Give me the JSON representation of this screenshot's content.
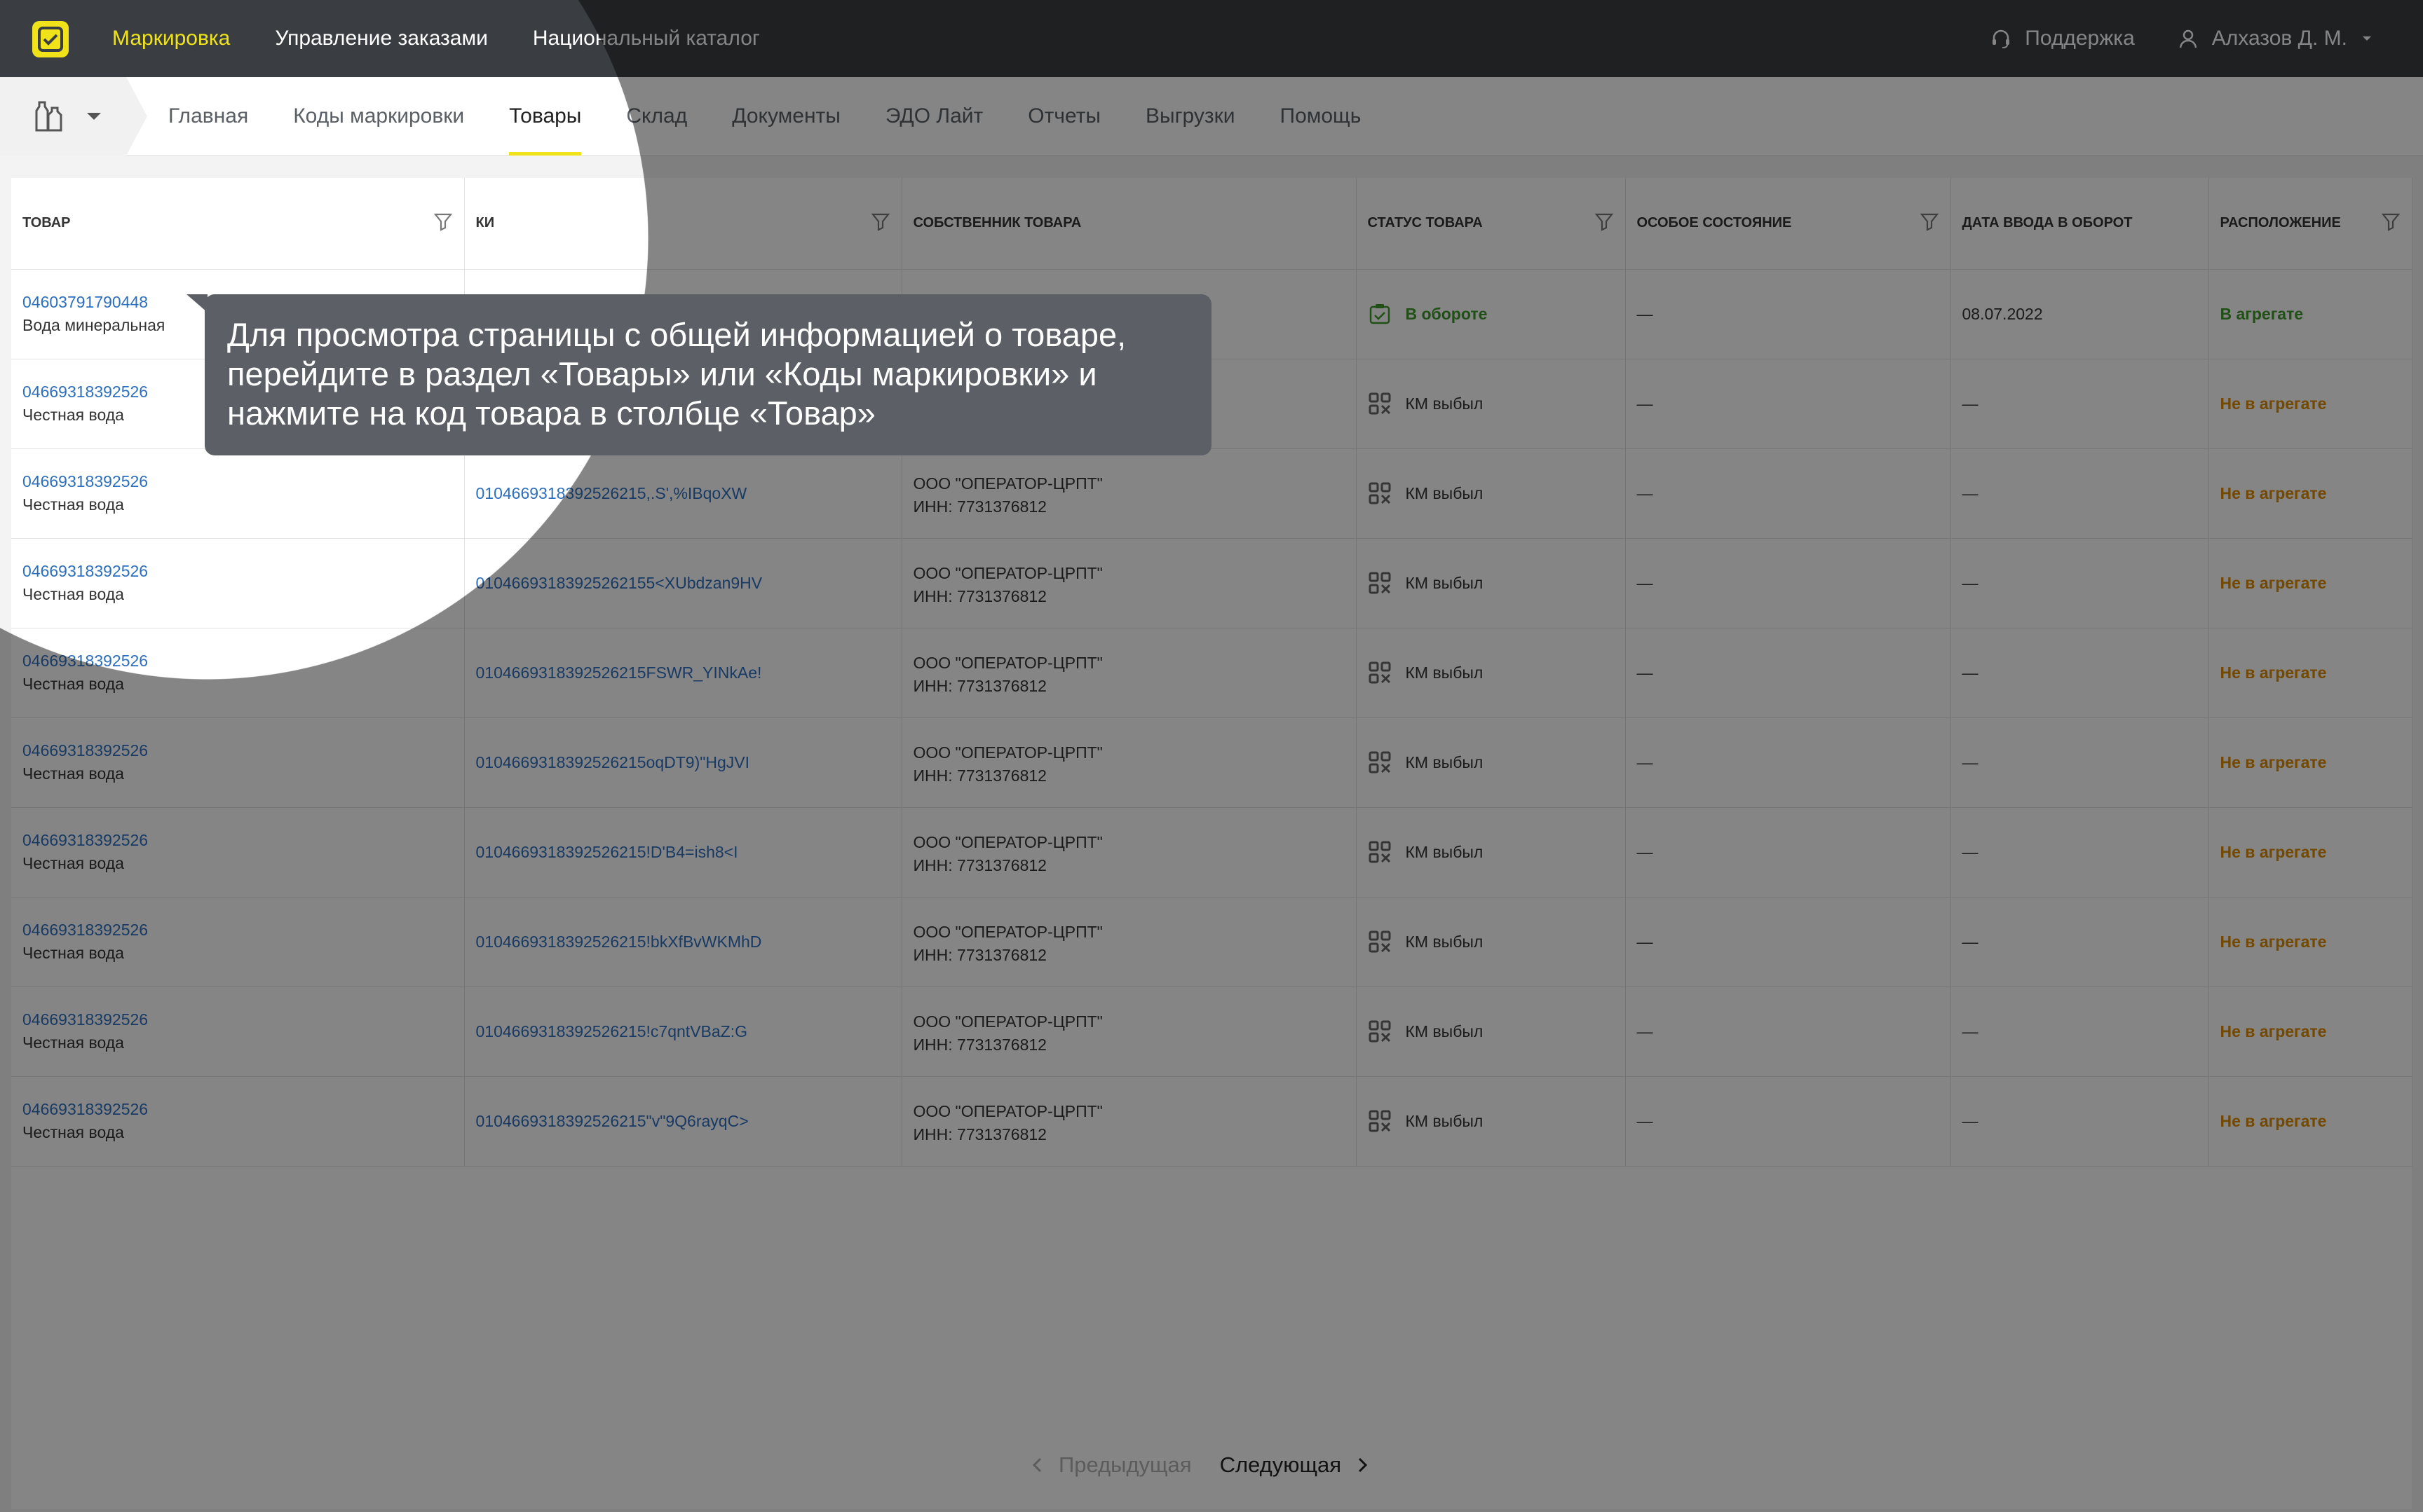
{
  "header": {
    "nav": [
      "Маркировка",
      "Управление заказами",
      "Национальный каталог"
    ],
    "active_index": 0,
    "support_label": "Поддержка",
    "user_name": "Алхазов Д. М."
  },
  "subnav": {
    "tabs": [
      "Главная",
      "Коды маркировки",
      "Товары",
      "Склад",
      "Документы",
      "ЭДО Лайт",
      "Отчеты",
      "Выгрузки",
      "Помощь"
    ],
    "active_index": 2
  },
  "table": {
    "columns": [
      "Товар",
      "КИ",
      "Собственник товара",
      "Статус товара",
      "Особое состояние",
      "Дата ввода в оборот",
      "Расположение"
    ],
    "rows": [
      {
        "gtin": "04603791790448",
        "name": "Вода минеральная",
        "ki": "",
        "owner": "",
        "inn": "",
        "status": "В обороте",
        "special": "—",
        "date": "08.07.2022",
        "location": "В агрегате"
      },
      {
        "gtin": "04669318392526",
        "name": "Честная вода",
        "ki": "",
        "owner": "",
        "inn": "",
        "status": "КМ выбыл",
        "special": "—",
        "date": "—",
        "location": "Не в агрегате"
      },
      {
        "gtin": "04669318392526",
        "name": "Честная вода",
        "ki": "0104669318392526215,.S',%IBqoXW",
        "owner": "ООО \"ОПЕРАТОР-ЦРПТ\"",
        "inn": "ИНН: 7731376812",
        "status": "КМ выбыл",
        "special": "—",
        "date": "—",
        "location": "Не в агрегате"
      },
      {
        "gtin": "04669318392526",
        "name": "Честная вода",
        "ki": "01046693183925262155<XUbdzan9HV",
        "owner": "ООО \"ОПЕРАТОР-ЦРПТ\"",
        "inn": "ИНН: 7731376812",
        "status": "КМ выбыл",
        "special": "—",
        "date": "—",
        "location": "Не в агрегате"
      },
      {
        "gtin": "04669318392526",
        "name": "Честная вода",
        "ki": "0104669318392526215FSWR_YINkAe!",
        "owner": "ООО \"ОПЕРАТОР-ЦРПТ\"",
        "inn": "ИНН: 7731376812",
        "status": "КМ выбыл",
        "special": "—",
        "date": "—",
        "location": "Не в агрегате"
      },
      {
        "gtin": "04669318392526",
        "name": "Честная вода",
        "ki": "0104669318392526215oqDT9)\"HgJVI",
        "owner": "ООО \"ОПЕРАТОР-ЦРПТ\"",
        "inn": "ИНН: 7731376812",
        "status": "КМ выбыл",
        "special": "—",
        "date": "—",
        "location": "Не в агрегате"
      },
      {
        "gtin": "04669318392526",
        "name": "Честная вода",
        "ki": "0104669318392526215!D'B4=ish8<I",
        "owner": "ООО \"ОПЕРАТОР-ЦРПТ\"",
        "inn": "ИНН: 7731376812",
        "status": "КМ выбыл",
        "special": "—",
        "date": "—",
        "location": "Не в агрегате"
      },
      {
        "gtin": "04669318392526",
        "name": "Честная вода",
        "ki": "0104669318392526215!bkXfBvWKMhD",
        "owner": "ООО \"ОПЕРАТОР-ЦРПТ\"",
        "inn": "ИНН: 7731376812",
        "status": "КМ выбыл",
        "special": "—",
        "date": "—",
        "location": "Не в агрегате"
      },
      {
        "gtin": "04669318392526",
        "name": "Честная вода",
        "ki": "0104669318392526215!c7qntVBaZ:G",
        "owner": "ООО \"ОПЕРАТОР-ЦРПТ\"",
        "inn": "ИНН: 7731376812",
        "status": "КМ выбыл",
        "special": "—",
        "date": "—",
        "location": "Не в агрегате"
      },
      {
        "gtin": "04669318392526",
        "name": "Честная вода",
        "ki": "0104669318392526215\"v\"9Q6rayqC>",
        "owner": "ООО \"ОПЕРАТОР-ЦРПТ\"",
        "inn": "ИНН: 7731376812",
        "status": "КМ выбыл",
        "special": "—",
        "date": "—",
        "location": "Не в агрегате"
      }
    ]
  },
  "pagination": {
    "prev_label": "Предыдущая",
    "next_label": "Следующая"
  },
  "tooltip": {
    "text": "Для просмотра страницы с общей информацией о товаре, перейдите в раздел «Товары» или «Коды маркировки» и нажмите на код товара в столбце «Товар»"
  },
  "colors": {
    "accent": "#f0e31a",
    "topbar": "#3a3d42",
    "link": "#2d6fbf",
    "status_green": "#3d9a2a",
    "status_orange": "#dd8a00"
  },
  "icons": {
    "logo": "check-logo-icon",
    "support": "headset-icon",
    "user": "user-icon",
    "filter": "filter-icon",
    "status_in_circulation": "barcode-check-icon",
    "status_retired": "qr-x-icon"
  }
}
